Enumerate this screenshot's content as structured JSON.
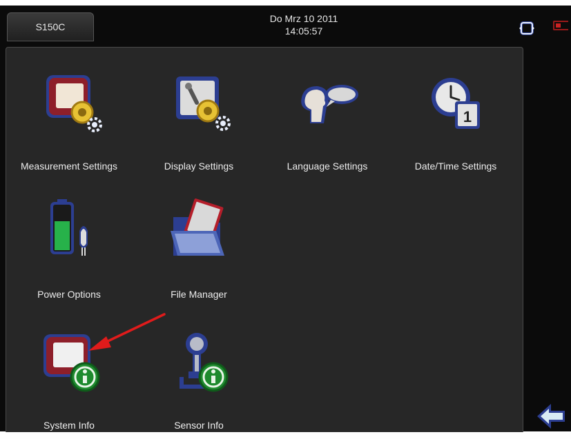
{
  "header": {
    "device_tab": "S150C",
    "date": "Do Mrz 10 2011",
    "time": "14:05:57"
  },
  "menu": {
    "items": [
      {
        "label": "Measurement Settings",
        "icon": "measurement-settings-icon"
      },
      {
        "label": "Display Settings",
        "icon": "display-settings-icon"
      },
      {
        "label": "Language Settings",
        "icon": "language-settings-icon"
      },
      {
        "label": "Date/Time Settings",
        "icon": "date-time-settings-icon"
      },
      {
        "label": "Power Options",
        "icon": "power-options-icon"
      },
      {
        "label": "File Manager",
        "icon": "file-manager-icon"
      },
      {
        "label": "System Info",
        "icon": "system-info-icon"
      },
      {
        "label": "Sensor Info",
        "icon": "sensor-info-icon"
      }
    ]
  },
  "calendar_day": "1",
  "colors": {
    "accent_arrow": "#e01b1b",
    "icon_frame": "#2c3e91",
    "info_badge": "#1e8a2e",
    "back_arrow": "#d8ebf4"
  }
}
